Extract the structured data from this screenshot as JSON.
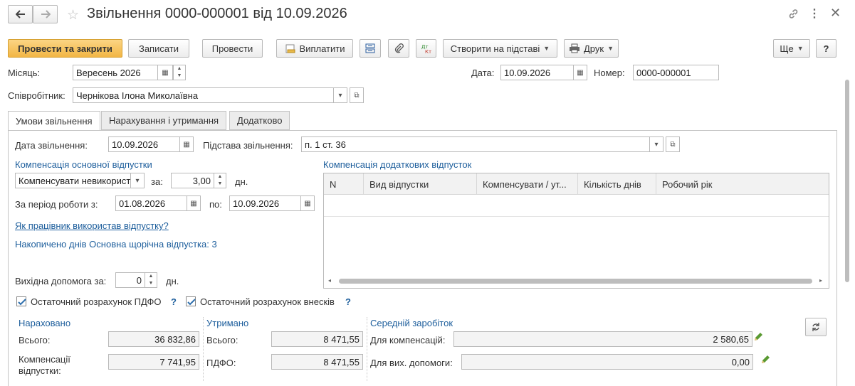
{
  "header": {
    "title": "Звільнення 0000-000001 від 10.09.2026"
  },
  "toolbar": {
    "post_close": "Провести та закрити",
    "save": "Записати",
    "post": "Провести",
    "pay": "Виплатити",
    "create_based": "Створити на підставі",
    "print": "Друк",
    "more": "Ще",
    "help": "?"
  },
  "form": {
    "month_label": "Місяць:",
    "month_value": "Вересень 2026",
    "date_label": "Дата:",
    "date_value": "10.09.2026",
    "number_label": "Номер:",
    "number_value": "0000-000001",
    "employee_label": "Співробітник:",
    "employee_value": "Чернікова Ілона Миколаївна"
  },
  "tabs": [
    "Умови звільнення",
    "Нарахування і утримання",
    "Додатково"
  ],
  "conditions": {
    "dismissal_date_label": "Дата звільнення:",
    "dismissal_date_value": "10.09.2026",
    "basis_label": "Підстава звільнення:",
    "basis_value": "п. 1 ст. 36",
    "main_comp_title": "Компенсація основної відпустки",
    "comp_mode_value": "Компенсувати невикористані",
    "for_label": "за:",
    "days_value": "3,00",
    "days_unit": "дн.",
    "period_label": "За період роботи з:",
    "period_from": "01.08.2026",
    "period_to_label": "по:",
    "period_to": "10.09.2026",
    "vacation_link": "Як працівник використав відпустку?",
    "accrued_text": "Накопичено днів Основна щорічна відпустка: 3",
    "severance_label": "Вихідна допомога за:",
    "severance_value": "0",
    "severance_unit": "дн.",
    "pit_label": "Остаточний розрахунок ПДФО",
    "contrib_label": "Остаточний розрахунок внесків",
    "add_comp_title": "Компенсація додаткових відпусток",
    "table_columns": [
      "N",
      "Вид відпустки",
      "Компенсувати / ут...",
      "Кількість днів",
      "Робочий рік"
    ]
  },
  "summary": {
    "accrued_title": "Нараховано",
    "total_label": "Всього:",
    "accrued_total": "36 832,86",
    "comp_label": "Компенсації відпустки:",
    "comp_value": "7 741,95",
    "withheld_title": "Утримано",
    "withheld_total_label": "Всього:",
    "withheld_total": "8 471,55",
    "pit_label": "ПДФО:",
    "pit_value": "8 471,55",
    "avg_title": "Середній заробіток",
    "avg_comp_label": "Для компенсацій:",
    "avg_comp_value": "2 580,65",
    "avg_sev_label": "Для вих. допомоги:",
    "avg_sev_value": "0,00"
  },
  "colors": {
    "accent_button": "#f2b645",
    "label_blue": "#1d5e9c",
    "edit_pencil": "#4a8a2a"
  }
}
